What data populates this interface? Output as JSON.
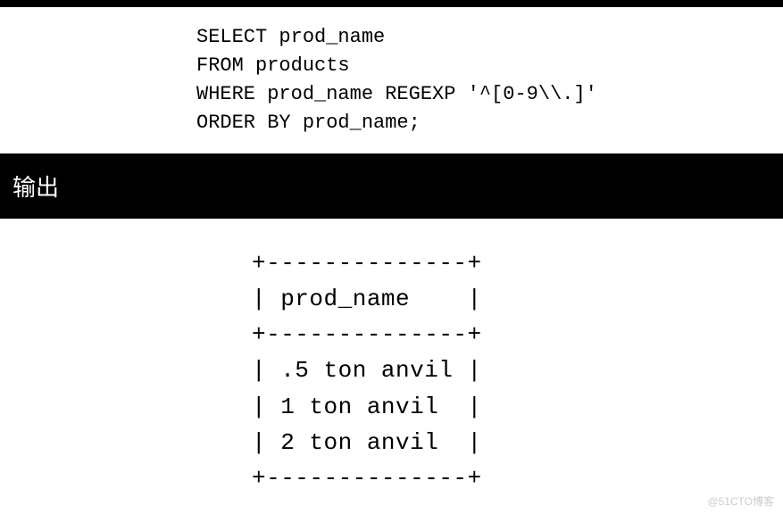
{
  "sql": {
    "line1": "SELECT prod_name",
    "line2": "FROM products",
    "line3": "WHERE prod_name REGEXP '^[0-9\\\\.]'",
    "line4": "ORDER BY prod_name;"
  },
  "output_label": "输出",
  "table": {
    "border": "+--------------+",
    "header": "| prod_name    |",
    "rows": [
      "| .5 ton anvil |",
      "| 1 ton anvil  |",
      "| 2 ton anvil  |"
    ]
  },
  "watermark": "@51CTO博客",
  "chart_data": {
    "type": "table",
    "title": "prod_name",
    "columns": [
      "prod_name"
    ],
    "rows": [
      [
        ".5 ton anvil"
      ],
      [
        "1 ton anvil"
      ],
      [
        "2 ton anvil"
      ]
    ]
  }
}
